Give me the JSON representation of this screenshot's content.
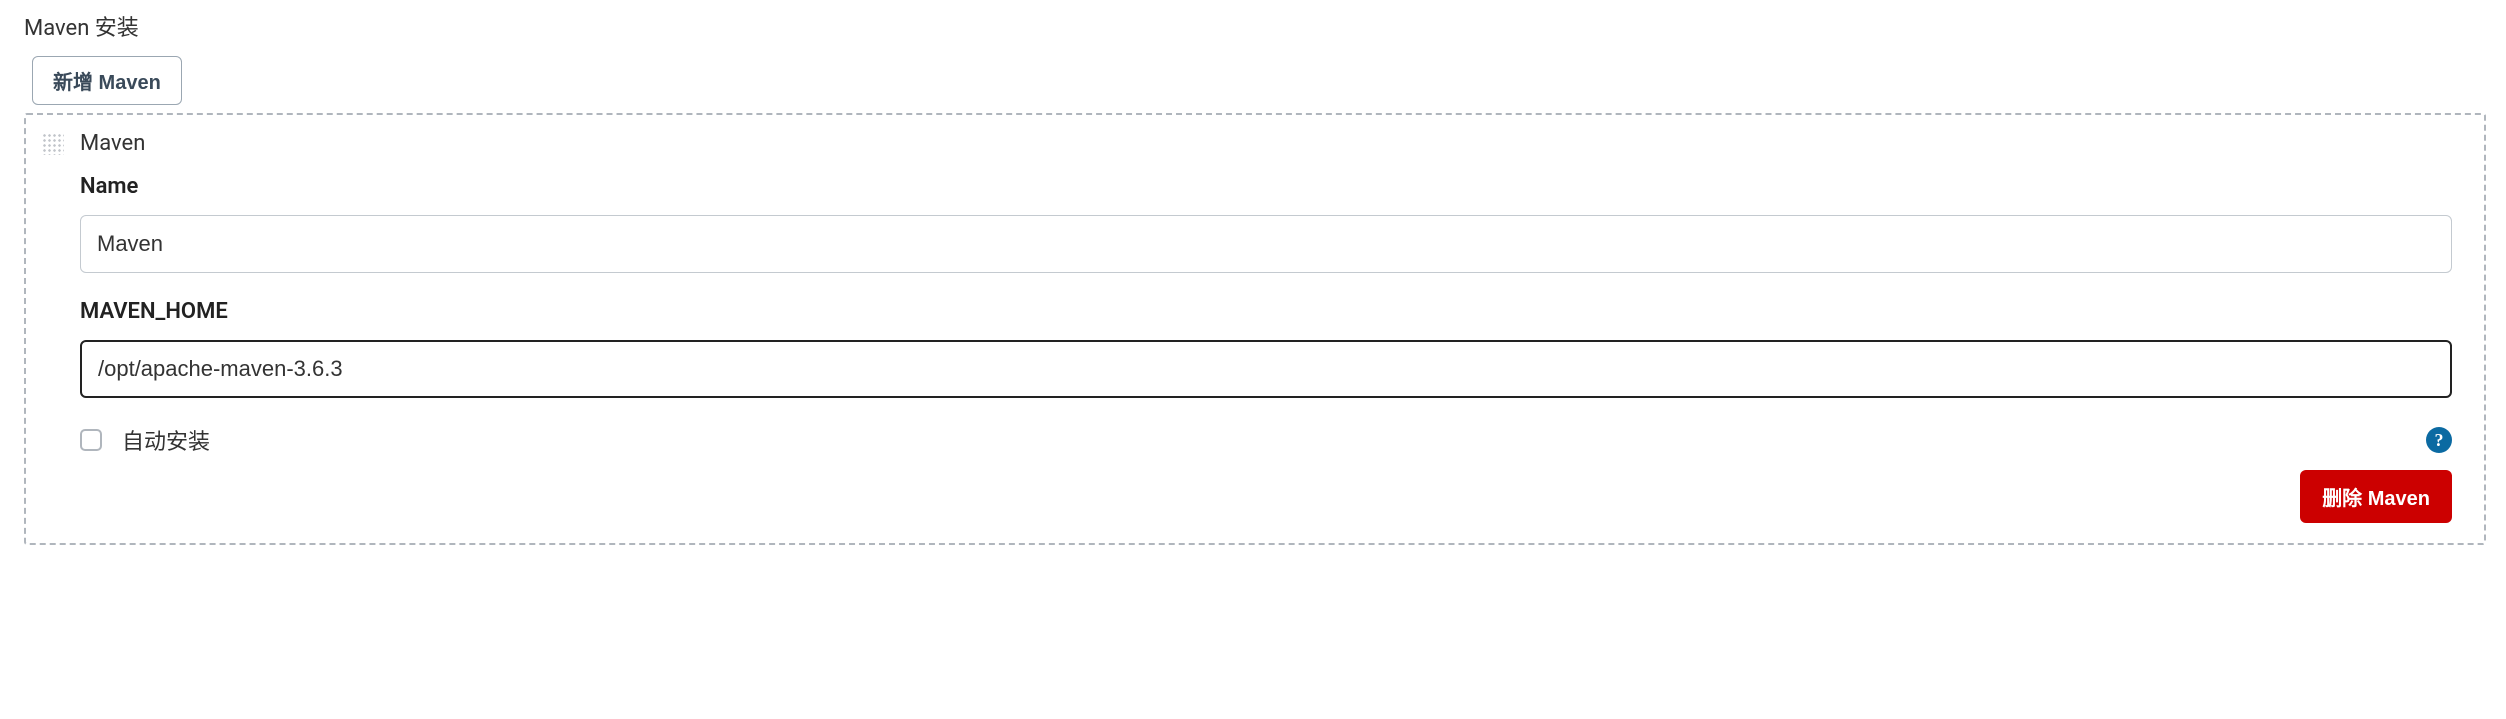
{
  "section": {
    "title": "Maven 安装",
    "add_button_label": "新增 Maven"
  },
  "installation": {
    "header": "Maven",
    "name": {
      "label": "Name",
      "value": "Maven"
    },
    "home": {
      "label": "MAVEN_HOME",
      "value": "/opt/apache-maven-3.6.3"
    },
    "auto_install": {
      "label": "自动安装",
      "checked": false
    },
    "delete_button_label": "删除 Maven"
  },
  "icons": {
    "help": "?"
  }
}
